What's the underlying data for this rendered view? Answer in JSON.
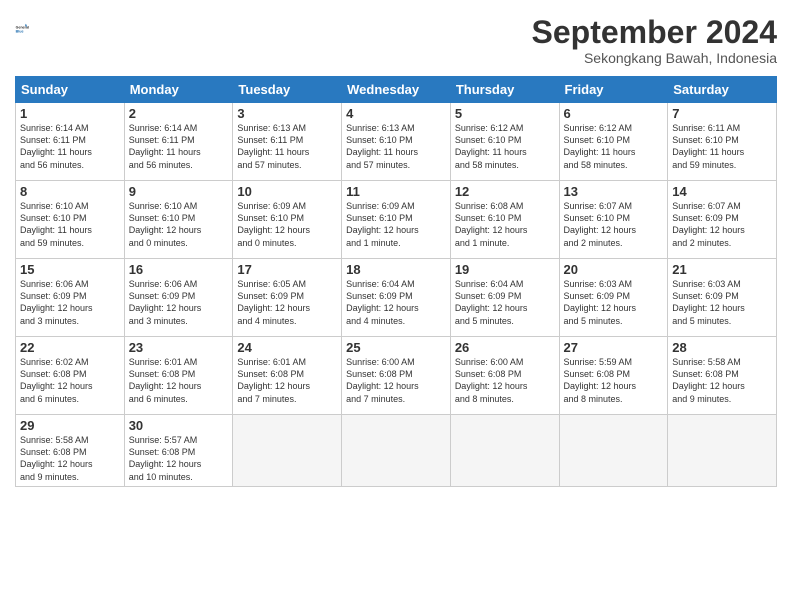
{
  "header": {
    "logo_general": "General",
    "logo_blue": "Blue",
    "month_title": "September 2024",
    "subtitle": "Sekongkang Bawah, Indonesia"
  },
  "weekdays": [
    "Sunday",
    "Monday",
    "Tuesday",
    "Wednesday",
    "Thursday",
    "Friday",
    "Saturday"
  ],
  "weeks": [
    [
      {
        "day": "1",
        "info": "Sunrise: 6:14 AM\nSunset: 6:11 PM\nDaylight: 11 hours\nand 56 minutes."
      },
      {
        "day": "2",
        "info": "Sunrise: 6:14 AM\nSunset: 6:11 PM\nDaylight: 11 hours\nand 56 minutes."
      },
      {
        "day": "3",
        "info": "Sunrise: 6:13 AM\nSunset: 6:11 PM\nDaylight: 11 hours\nand 57 minutes."
      },
      {
        "day": "4",
        "info": "Sunrise: 6:13 AM\nSunset: 6:10 PM\nDaylight: 11 hours\nand 57 minutes."
      },
      {
        "day": "5",
        "info": "Sunrise: 6:12 AM\nSunset: 6:10 PM\nDaylight: 11 hours\nand 58 minutes."
      },
      {
        "day": "6",
        "info": "Sunrise: 6:12 AM\nSunset: 6:10 PM\nDaylight: 11 hours\nand 58 minutes."
      },
      {
        "day": "7",
        "info": "Sunrise: 6:11 AM\nSunset: 6:10 PM\nDaylight: 11 hours\nand 59 minutes."
      }
    ],
    [
      {
        "day": "8",
        "info": "Sunrise: 6:10 AM\nSunset: 6:10 PM\nDaylight: 11 hours\nand 59 minutes."
      },
      {
        "day": "9",
        "info": "Sunrise: 6:10 AM\nSunset: 6:10 PM\nDaylight: 12 hours\nand 0 minutes."
      },
      {
        "day": "10",
        "info": "Sunrise: 6:09 AM\nSunset: 6:10 PM\nDaylight: 12 hours\nand 0 minutes."
      },
      {
        "day": "11",
        "info": "Sunrise: 6:09 AM\nSunset: 6:10 PM\nDaylight: 12 hours\nand 1 minute."
      },
      {
        "day": "12",
        "info": "Sunrise: 6:08 AM\nSunset: 6:10 PM\nDaylight: 12 hours\nand 1 minute."
      },
      {
        "day": "13",
        "info": "Sunrise: 6:07 AM\nSunset: 6:10 PM\nDaylight: 12 hours\nand 2 minutes."
      },
      {
        "day": "14",
        "info": "Sunrise: 6:07 AM\nSunset: 6:09 PM\nDaylight: 12 hours\nand 2 minutes."
      }
    ],
    [
      {
        "day": "15",
        "info": "Sunrise: 6:06 AM\nSunset: 6:09 PM\nDaylight: 12 hours\nand 3 minutes."
      },
      {
        "day": "16",
        "info": "Sunrise: 6:06 AM\nSunset: 6:09 PM\nDaylight: 12 hours\nand 3 minutes."
      },
      {
        "day": "17",
        "info": "Sunrise: 6:05 AM\nSunset: 6:09 PM\nDaylight: 12 hours\nand 4 minutes."
      },
      {
        "day": "18",
        "info": "Sunrise: 6:04 AM\nSunset: 6:09 PM\nDaylight: 12 hours\nand 4 minutes."
      },
      {
        "day": "19",
        "info": "Sunrise: 6:04 AM\nSunset: 6:09 PM\nDaylight: 12 hours\nand 5 minutes."
      },
      {
        "day": "20",
        "info": "Sunrise: 6:03 AM\nSunset: 6:09 PM\nDaylight: 12 hours\nand 5 minutes."
      },
      {
        "day": "21",
        "info": "Sunrise: 6:03 AM\nSunset: 6:09 PM\nDaylight: 12 hours\nand 5 minutes."
      }
    ],
    [
      {
        "day": "22",
        "info": "Sunrise: 6:02 AM\nSunset: 6:08 PM\nDaylight: 12 hours\nand 6 minutes."
      },
      {
        "day": "23",
        "info": "Sunrise: 6:01 AM\nSunset: 6:08 PM\nDaylight: 12 hours\nand 6 minutes."
      },
      {
        "day": "24",
        "info": "Sunrise: 6:01 AM\nSunset: 6:08 PM\nDaylight: 12 hours\nand 7 minutes."
      },
      {
        "day": "25",
        "info": "Sunrise: 6:00 AM\nSunset: 6:08 PM\nDaylight: 12 hours\nand 7 minutes."
      },
      {
        "day": "26",
        "info": "Sunrise: 6:00 AM\nSunset: 6:08 PM\nDaylight: 12 hours\nand 8 minutes."
      },
      {
        "day": "27",
        "info": "Sunrise: 5:59 AM\nSunset: 6:08 PM\nDaylight: 12 hours\nand 8 minutes."
      },
      {
        "day": "28",
        "info": "Sunrise: 5:58 AM\nSunset: 6:08 PM\nDaylight: 12 hours\nand 9 minutes."
      }
    ],
    [
      {
        "day": "29",
        "info": "Sunrise: 5:58 AM\nSunset: 6:08 PM\nDaylight: 12 hours\nand 9 minutes."
      },
      {
        "day": "30",
        "info": "Sunrise: 5:57 AM\nSunset: 6:08 PM\nDaylight: 12 hours\nand 10 minutes."
      },
      {
        "day": "",
        "info": ""
      },
      {
        "day": "",
        "info": ""
      },
      {
        "day": "",
        "info": ""
      },
      {
        "day": "",
        "info": ""
      },
      {
        "day": "",
        "info": ""
      }
    ]
  ]
}
